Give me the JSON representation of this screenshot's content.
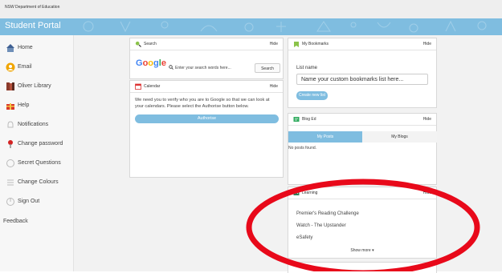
{
  "header": {
    "department": "NSW Department of Education",
    "portal_title": "Student Portal"
  },
  "sidebar": {
    "items": [
      {
        "label": "Home",
        "icon": "home-icon"
      },
      {
        "label": "Email",
        "icon": "email-icon"
      },
      {
        "label": "Oliver Library",
        "icon": "library-icon"
      },
      {
        "label": "Help",
        "icon": "help-icon"
      },
      {
        "label": "Notifications",
        "icon": "bell-icon"
      },
      {
        "label": "Change password",
        "icon": "key-icon"
      },
      {
        "label": "Secret Questions",
        "icon": "question-icon"
      },
      {
        "label": "Change Colours",
        "icon": "palette-icon"
      },
      {
        "label": "Sign Out",
        "icon": "power-icon"
      }
    ],
    "feedback": "Feedback"
  },
  "search_card": {
    "title": "Search",
    "hide": "Hide",
    "google_logo": "Google",
    "placeholder": "Enter your search words here...",
    "button": "Search"
  },
  "calendar_card": {
    "title": "Calendar",
    "hide": "Hide",
    "message": "We need you to verify who you are to Google so that we can look at your calendars. Please select the Authorise button below.",
    "button": "Authorise"
  },
  "bookmarks_card": {
    "title": "My Bookmarks",
    "hide": "Hide",
    "list_label": "List name",
    "input_placeholder": "Name your custom bookmarks list here...",
    "create_button": "Create new list"
  },
  "blog_card": {
    "title": "Blog Ed",
    "hide": "Hide",
    "tabs": [
      "My Posts",
      "My Blogs"
    ],
    "no_posts": "No posts found."
  },
  "learning_card": {
    "title": "Learning",
    "hide": "Hide",
    "items": [
      "Premier's Reading Challenge",
      "Watch - The Upstander",
      "eSafety"
    ],
    "show_more": "Show more ▾"
  },
  "colors": {
    "accent": "#7fbde0",
    "highlight_ring": "#e8091a"
  }
}
